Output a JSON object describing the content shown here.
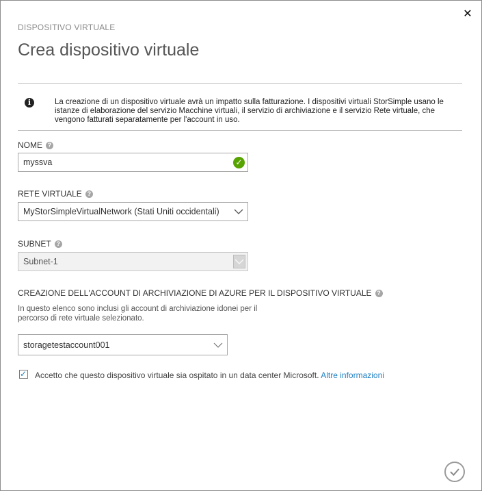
{
  "dialog": {
    "eyebrow": "DISPOSITIVO VIRTUALE",
    "title": "Crea dispositivo virtuale",
    "close_icon": "close-icon",
    "confirm_icon": "check-circle-icon"
  },
  "info": {
    "icon": "info-icon",
    "text": "La creazione di un dispositivo virtuale avrà un impatto sulla fatturazione. I dispositivi virtuali StorSimple usano le istanze di elaborazione del servizio Macchine virtuali, il servizio di archiviazione e il servizio Rete virtuale, che vengono fatturati separatamente per l'account in uso."
  },
  "form": {
    "name": {
      "label": "NOME",
      "value": "myssva",
      "status_icon": "valid-check-icon"
    },
    "network": {
      "label": "RETE VIRTUALE",
      "value": "MyStorSimpleVirtualNetwork (Stati Uniti occidentali)"
    },
    "subnet": {
      "label": "SUBNET",
      "value": "Subnet-1"
    },
    "storage": {
      "label": "CREAZIONE DELL'ACCOUNT DI ARCHIVIAZIONE DI AZURE PER IL DISPOSITIVO VIRTUALE",
      "description": "In questo elenco sono inclusi gli account di archiviazione idonei per il percorso di rete virtuale selezionato.",
      "value": "storagetestaccount001"
    },
    "accept": {
      "checked": true,
      "text": "Accetto che questo dispositivo virtuale sia ospitato in un data center Microsoft.",
      "link": "Altre informazioni"
    }
  },
  "colors": {
    "accent": "#1f7fc1",
    "success": "#57a300",
    "border": "#a6a6a6"
  }
}
